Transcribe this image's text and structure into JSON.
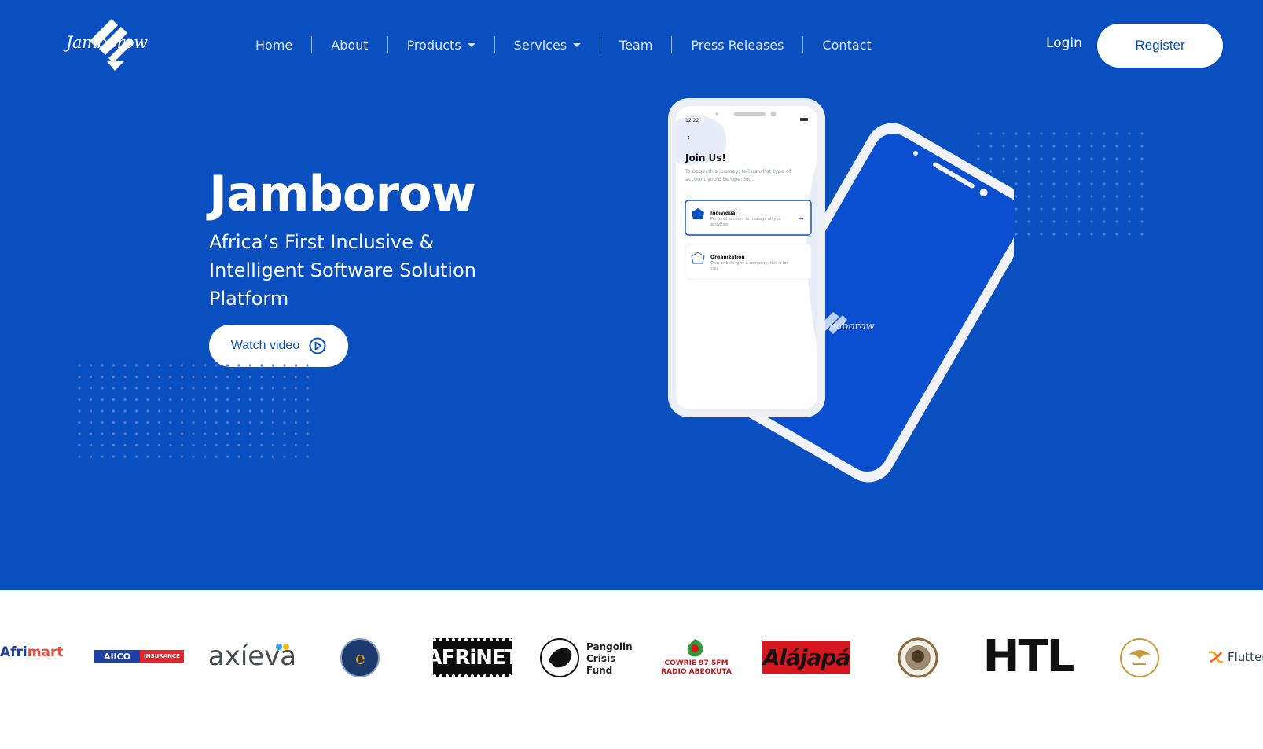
{
  "brand": {
    "logo_text": "Jamborow",
    "colors": {
      "primary": "#0a4fc0",
      "white": "#ffffff"
    }
  },
  "nav": {
    "items": [
      {
        "label": "Home"
      },
      {
        "label": "About"
      },
      {
        "label": "Products",
        "dropdown": true
      },
      {
        "label": "Services",
        "dropdown": true
      },
      {
        "label": "Team"
      },
      {
        "label": "Press Releases"
      },
      {
        "label": "Contact"
      }
    ],
    "login_label": "Login",
    "register_label": "Register"
  },
  "hero": {
    "title": "Jamborow",
    "tagline": "Africa’s First Inclusive & Intelligent Software Solution Platform",
    "watch_label": "Watch video"
  },
  "phone": {
    "status_time": "12:22",
    "heading": "Join Us!",
    "intro": "To begin this journey, tell us what type of account you'd be opening.",
    "options": [
      {
        "title": "Individual",
        "desc": "Personal account to manage all you activities."
      },
      {
        "title": "Organization",
        "desc": "Own or belong to a company, this is for you."
      }
    ],
    "back_logo_text": "Jamborow"
  },
  "partners": {
    "afrimart": {
      "a": "Afri",
      "b": "mart"
    },
    "aiico": {
      "a": "AIICO",
      "b": "INSURANCE"
    },
    "axieva": "axíeva",
    "afrinet": "AFRiNET",
    "pangolin": [
      "Pangolin",
      "Crisis",
      "Fund"
    ],
    "cowrie": [
      "COWRIE 97.5FM",
      "RADIO ABEOKUTA"
    ],
    "alajapa": "Alájapá",
    "htl": "HTL",
    "flutter": "Flutter"
  }
}
